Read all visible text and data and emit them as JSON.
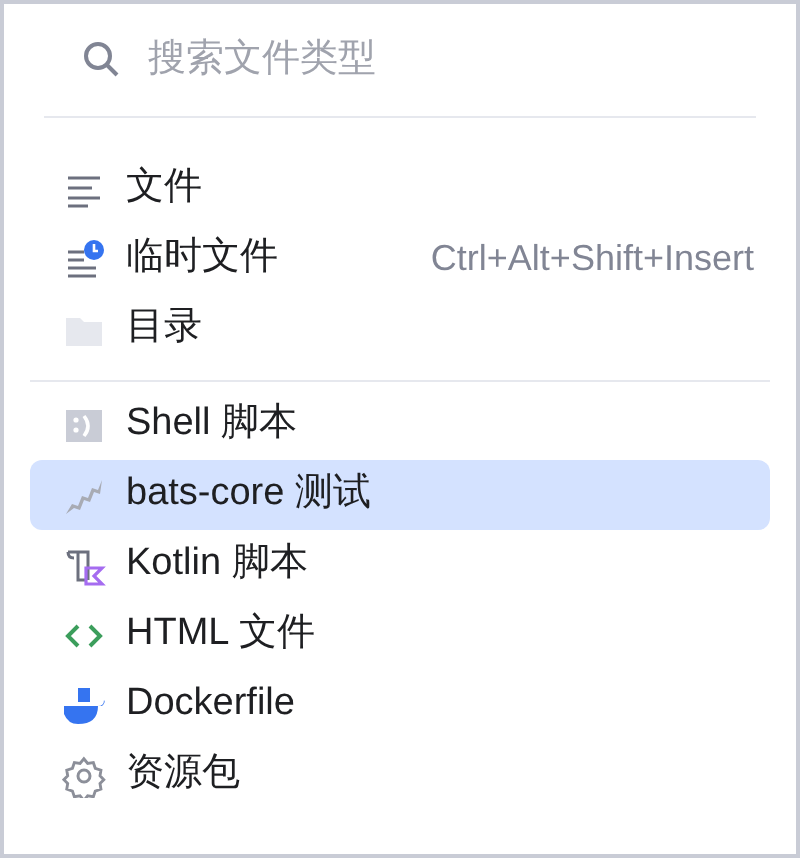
{
  "search": {
    "placeholder": "搜索文件类型"
  },
  "groups": [
    {
      "items": [
        {
          "kind": "file",
          "label": "文件",
          "selected": false
        },
        {
          "kind": "scratch",
          "label": "临时文件",
          "shortcut": "Ctrl+Alt+Shift+Insert",
          "selected": false
        },
        {
          "kind": "folder",
          "label": "目录",
          "selected": false
        }
      ]
    },
    {
      "items": [
        {
          "kind": "shell",
          "label": "Shell 脚本",
          "selected": false
        },
        {
          "kind": "bats",
          "label": "bats-core 测试",
          "selected": true
        },
        {
          "kind": "kotlin",
          "label": "Kotlin 脚本",
          "selected": false
        },
        {
          "kind": "html",
          "label": "HTML 文件",
          "selected": false
        },
        {
          "kind": "docker",
          "label": "Dockerfile",
          "selected": false
        },
        {
          "kind": "resource",
          "label": "资源包",
          "selected": false
        }
      ]
    }
  ]
}
